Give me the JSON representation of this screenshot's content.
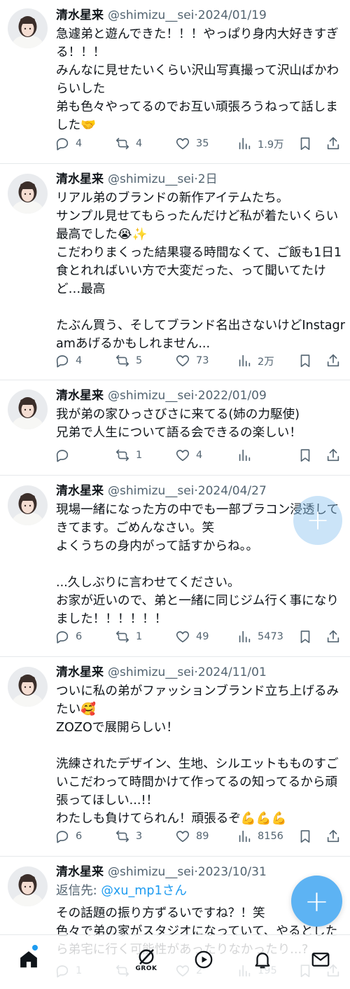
{
  "user": {
    "name": "清水星来",
    "handle": "@shimizu__sei"
  },
  "tweets": [
    {
      "date": "2024/01/19",
      "text": "急遽弟と遊んできた！！！やっぱり身内大好きすぎる！！！\nみんなに見せたいくらい沢山写真撮って沢山ばかわらいした\n弟も色々やってるのでお互い頑張ろうねって話しました🤝",
      "replies": "4",
      "reposts": "4",
      "likes": "35",
      "views": "1.9万"
    },
    {
      "date": "2日",
      "text": "リアル弟のブランドの新作アイテムたち。\nサンプル見せてもらったんだけど私が着たいくらい最高でした😭✨\nこだわりまくった結果寝る時間なくて、ご飯も1日1食とれればいい方で大変だった、って聞いてたけど…最高\n\nたぶん買う、そしてブランド名出さないけどInstagramあげるかもしれません...",
      "replies": "4",
      "reposts": "5",
      "likes": "73",
      "views": "2万"
    },
    {
      "date": "2022/01/09",
      "text": "我が弟の家ひっさびさに来てる(姉の力駆使)\n兄弟で人生について語る会できるの楽しい！",
      "replies": "",
      "reposts": "1",
      "likes": "4",
      "views": ""
    },
    {
      "date": "2024/04/27",
      "text": "現場一緒になった方の中でも一部ブラコン浸透してきてます。ごめんなさい。笑\nよくうちの身内がって話すからね。。\n\n...久しぶりに言わせてください。\nお家が近いので、弟と一緒に同じジム行く事になりました！！！！！！",
      "replies": "6",
      "reposts": "1",
      "likes": "49",
      "views": "5473"
    },
    {
      "date": "2024/11/01",
      "text": "ついに私の弟がファッションブランド立ち上げるみたい🥰\nZOZOで展開らしい！\n\n洗練されたデザイン、生地、シルエットもものすごいこだわって時間かけて作ってるの知ってるから頑張ってほしい...!！\nわたしも負けてられん！頑張るぞ💪💪💪",
      "replies": "6",
      "reposts": "3",
      "likes": "89",
      "views": "8156"
    },
    {
      "date": "2023/10/31",
      "reply_label": "返信先: ",
      "reply_mention": "@xu_mp1さん",
      "text": "その話題の振り方ずるいですね？！笑\n色々で弟の家がスタジオになっていて、やるとしたら弟宅に行く可能性があったりなかったり...?",
      "replies": "1",
      "reposts": "",
      "likes": "2",
      "views": "195"
    }
  ],
  "fab_label": "+",
  "bottom_nav": {
    "grok_label": "GROK",
    "items": [
      "home-icon",
      "grok-icon",
      "video-icon",
      "notifications-icon",
      "messages-icon"
    ]
  },
  "colors": {
    "accent": "#1d9bf0",
    "secondary_text": "#536471",
    "fab": "#5db3f3"
  }
}
